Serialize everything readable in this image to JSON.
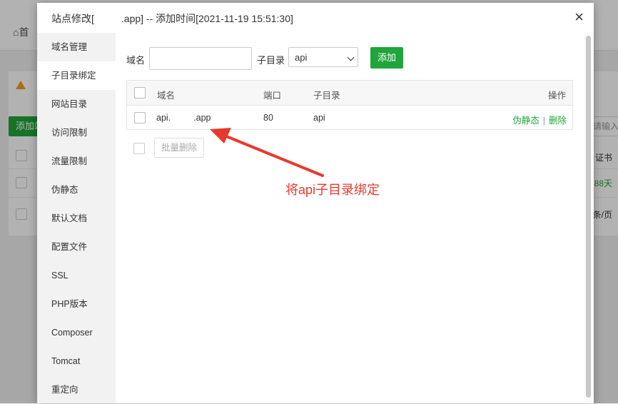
{
  "background": {
    "home_label": "首",
    "add_button_label": "添加站",
    "search_placeholder": "请输入",
    "col_cert": "证书",
    "days_remaining": "88天",
    "page_size": "条/页"
  },
  "modal": {
    "title_prefix": "站点修改[",
    "title_suffix": ".app] -- 添加时间[2021-11-19 15:51:30]",
    "close_glyph": "×"
  },
  "sidebar": {
    "items": [
      {
        "label": "域名管理"
      },
      {
        "label": "子目录绑定"
      },
      {
        "label": "网站目录"
      },
      {
        "label": "访问限制"
      },
      {
        "label": "流量限制"
      },
      {
        "label": "伪静态"
      },
      {
        "label": "默认文档"
      },
      {
        "label": "配置文件"
      },
      {
        "label": "SSL"
      },
      {
        "label": "PHP版本"
      },
      {
        "label": "Composer"
      },
      {
        "label": "Tomcat"
      },
      {
        "label": "重定向"
      }
    ],
    "active_index": 1
  },
  "form": {
    "domain_label": "域名",
    "domain_value": "",
    "subdir_label": "子目录",
    "subdir_selected": "api",
    "add_label": "添加"
  },
  "table": {
    "headers": {
      "domain": "域名",
      "port": "端口",
      "subdir": "子目录",
      "action": "操作"
    },
    "rows": [
      {
        "domain_prefix": "api.",
        "domain_suffix": ".app",
        "port": "80",
        "subdir": "api",
        "rewrite": "伪静态",
        "delete": "删除",
        "sep": "|"
      }
    ]
  },
  "batch_delete_label": "批量删除",
  "annotation": {
    "text": "将api子目录绑定",
    "color": "#e8392e"
  },
  "colors": {
    "accent": "#20a53a"
  }
}
